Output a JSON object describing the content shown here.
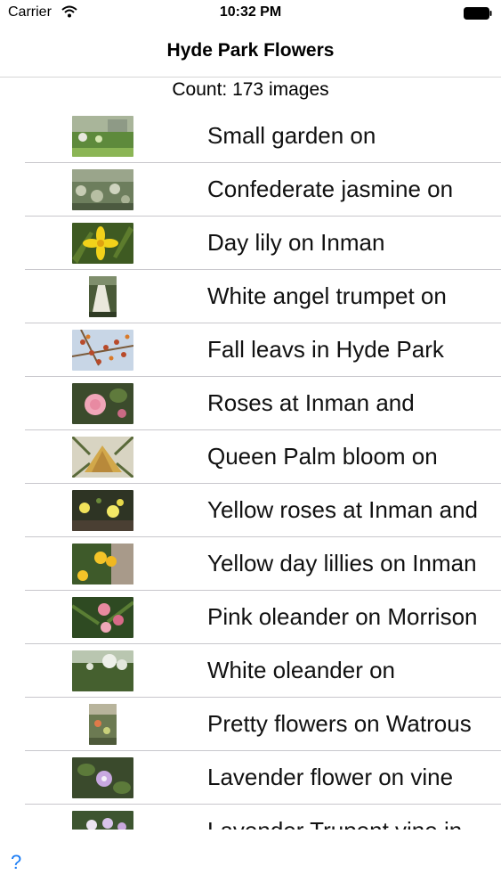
{
  "status_bar": {
    "carrier": "Carrier",
    "time": "10:32 PM"
  },
  "nav": {
    "title": "Hyde Park Flowers"
  },
  "count_label": "Count: 173 images",
  "rows": [
    {
      "label": "Small garden on",
      "thumb": "garden-photo",
      "shape": "wide"
    },
    {
      "label": "Confederate jasmine on",
      "thumb": "jasmine-photo",
      "shape": "wide"
    },
    {
      "label": "Day lily on Inman",
      "thumb": "day-lily-photo",
      "shape": "wide"
    },
    {
      "label": "White angel trumpet on",
      "thumb": "angel-trumpet-photo",
      "shape": "tall"
    },
    {
      "label": "Fall leavs in Hyde Park",
      "thumb": "fall-leaves-photo",
      "shape": "wide"
    },
    {
      "label": "Roses at Inman and",
      "thumb": "rose-photo",
      "shape": "wide"
    },
    {
      "label": "Queen Palm bloom on",
      "thumb": "palm-bloom-photo",
      "shape": "wide"
    },
    {
      "label": "Yellow roses at Inman and",
      "thumb": "yellow-roses-photo",
      "shape": "wide"
    },
    {
      "label": "Yellow day lillies on Inman",
      "thumb": "yellow-lilies-photo",
      "shape": "wide"
    },
    {
      "label": "Pink oleander on Morrison",
      "thumb": "pink-oleander-photo",
      "shape": "wide"
    },
    {
      "label": "White oleander on",
      "thumb": "white-oleander-photo",
      "shape": "wide"
    },
    {
      "label": "Pretty flowers on Watrous",
      "thumb": "pretty-flowers-photo",
      "shape": "tall"
    },
    {
      "label": "Lavender flower on vine",
      "thumb": "lavender-flower-photo",
      "shape": "wide"
    },
    {
      "label": "Lavender Trupent vine in",
      "thumb": "lavender-vine-photo",
      "shape": "wide"
    }
  ],
  "bottom_toolbar": {
    "help_label": "?"
  }
}
